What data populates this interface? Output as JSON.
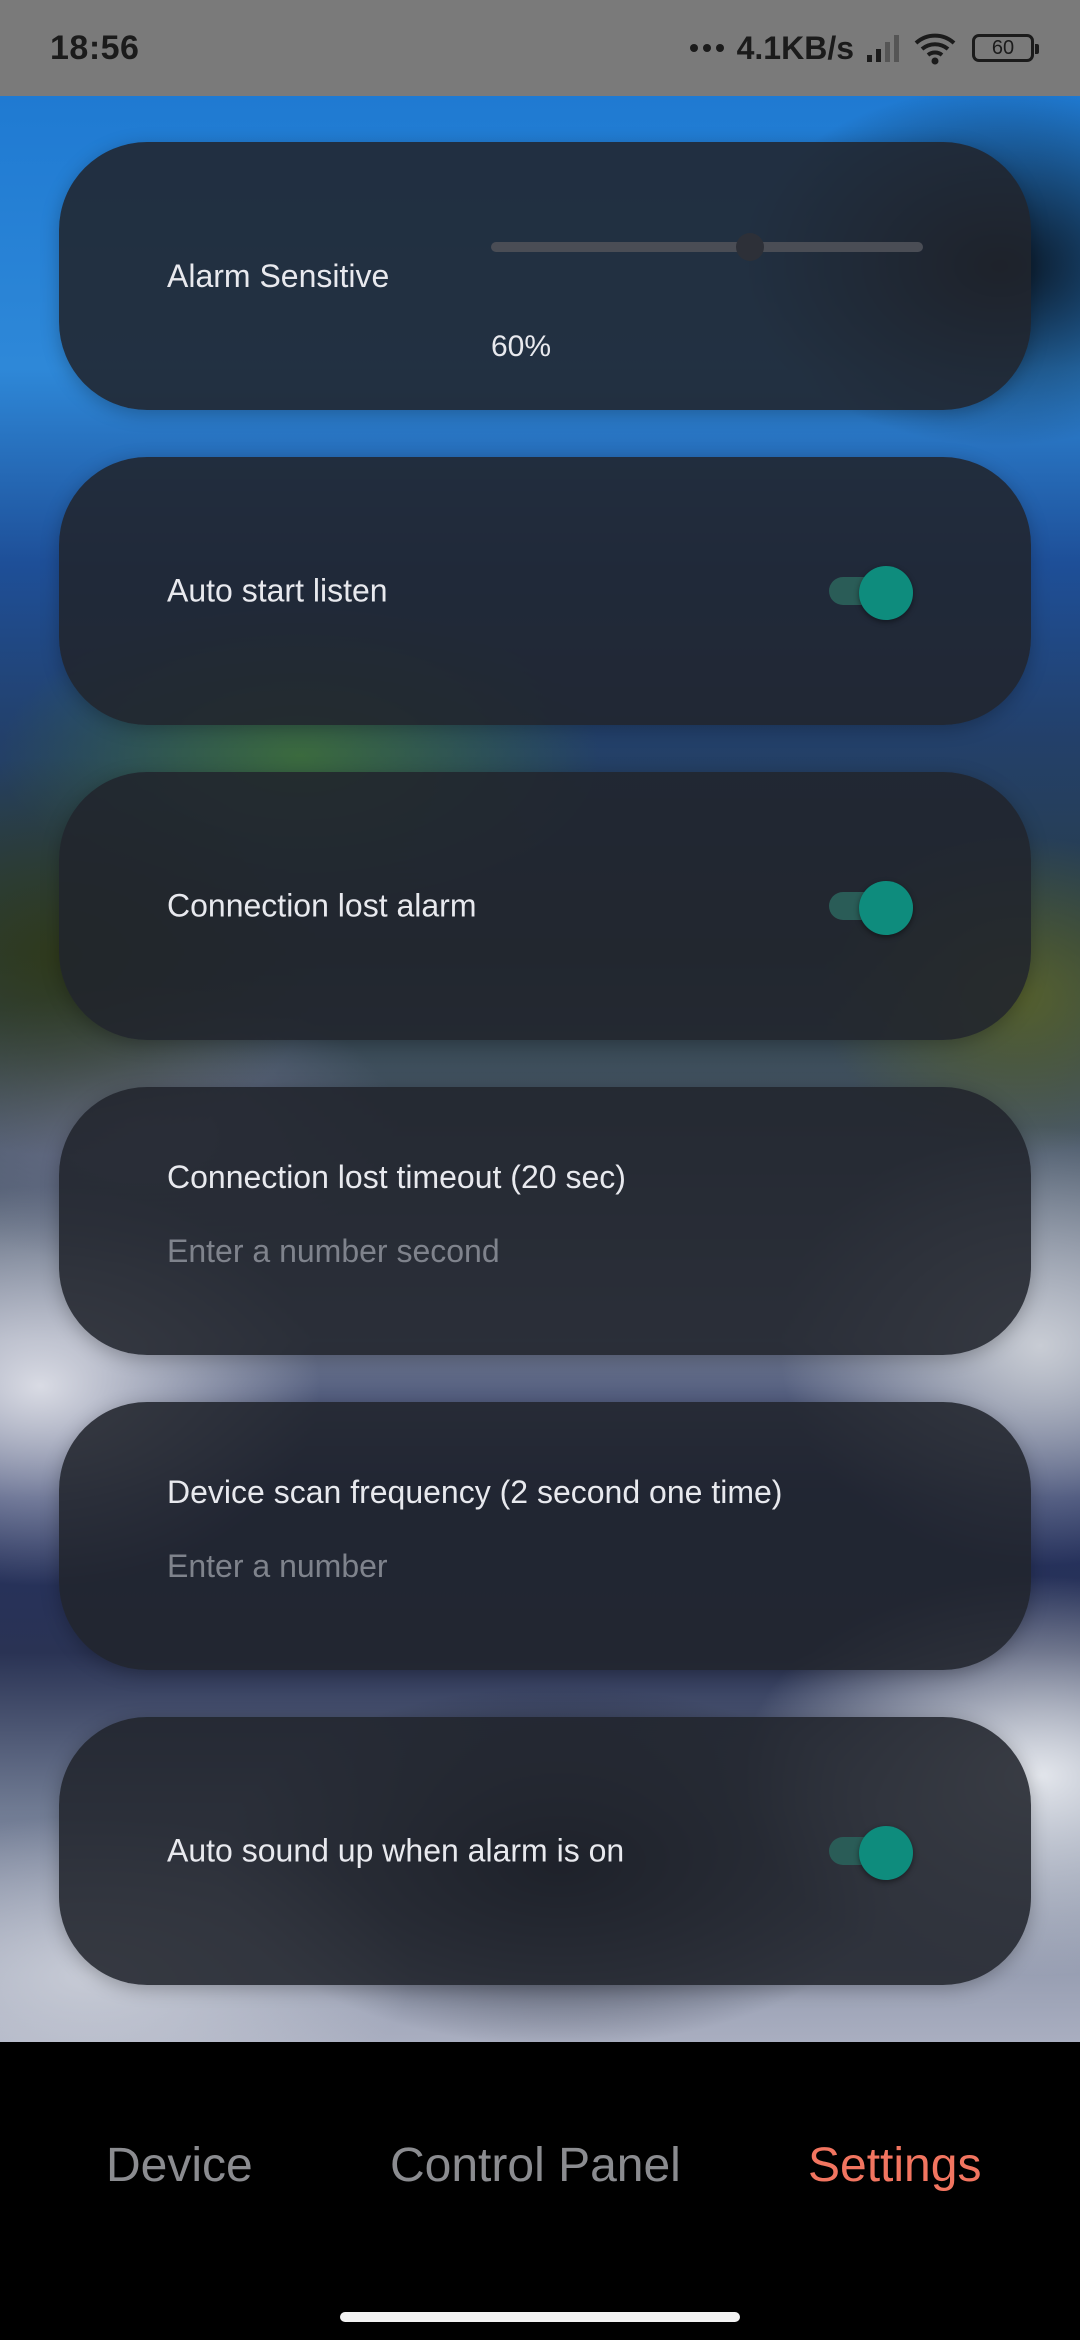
{
  "status_bar": {
    "time": "18:56",
    "network_speed": "4.1KB/s",
    "battery": "60",
    "icons": [
      "more-dots-icon",
      "signal-icon",
      "wifi-icon",
      "battery-icon"
    ]
  },
  "settings": {
    "alarm_sensitive": {
      "label": "Alarm Sensitive",
      "value_text": "60%",
      "slider_fraction": 0.6
    },
    "auto_start_listen": {
      "label": "Auto start listen",
      "enabled": true
    },
    "connection_lost_alarm": {
      "label": "Connection lost alarm",
      "enabled": true
    },
    "connection_lost_timeout": {
      "label": "Connection lost timeout (20 sec)",
      "value": "",
      "placeholder": "Enter a number second"
    },
    "device_scan_frequency": {
      "label": "Device scan frequency (2 second one time)",
      "value": "",
      "placeholder": "Enter a number"
    },
    "auto_sound_up": {
      "label": "Auto sound up when alarm is on",
      "enabled": true
    }
  },
  "nav": {
    "tabs": [
      {
        "label": "Device",
        "active": false
      },
      {
        "label": "Control Panel",
        "active": false
      },
      {
        "label": "Settings",
        "active": true
      }
    ]
  },
  "colors": {
    "accent": "#0e8c7d",
    "active_tab": "#f27560",
    "inactive_tab": "#8b8c90"
  }
}
